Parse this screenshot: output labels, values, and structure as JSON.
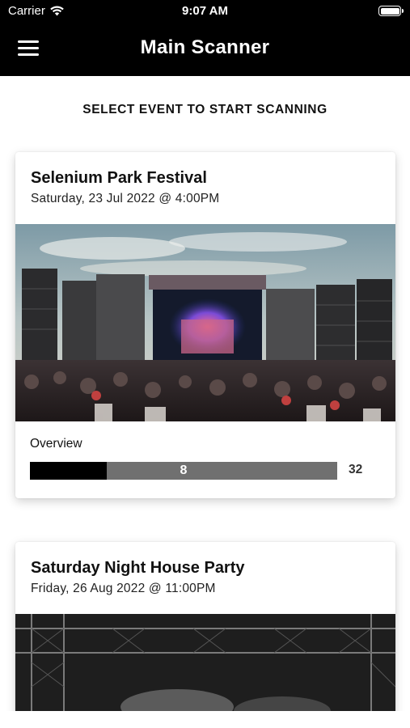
{
  "status_bar": {
    "carrier": "Carrier",
    "time": "9:07 AM",
    "wifi_icon": "wifi-icon",
    "battery_icon": "battery-full-icon"
  },
  "nav": {
    "menu_icon": "hamburger-menu-icon",
    "title": "Main Scanner"
  },
  "section_heading": "SELECT EVENT TO START SCANNING",
  "events": [
    {
      "title": "Selenium Park Festival",
      "date": "Saturday, 23 Jul 2022 @ 4:00PM",
      "image": "concert-crowd-photo",
      "overview_label": "Overview",
      "progress_value": "8",
      "progress_total": "32",
      "progress_fraction": 0.25
    },
    {
      "title": "Saturday Night House Party",
      "date": "Friday, 26 Aug 2022 @ 11:00PM",
      "image": "dark-stage-truss-photo"
    }
  ],
  "colors": {
    "bar_background": "#000000",
    "progress_fill": "#000000",
    "progress_track": "#707070"
  }
}
